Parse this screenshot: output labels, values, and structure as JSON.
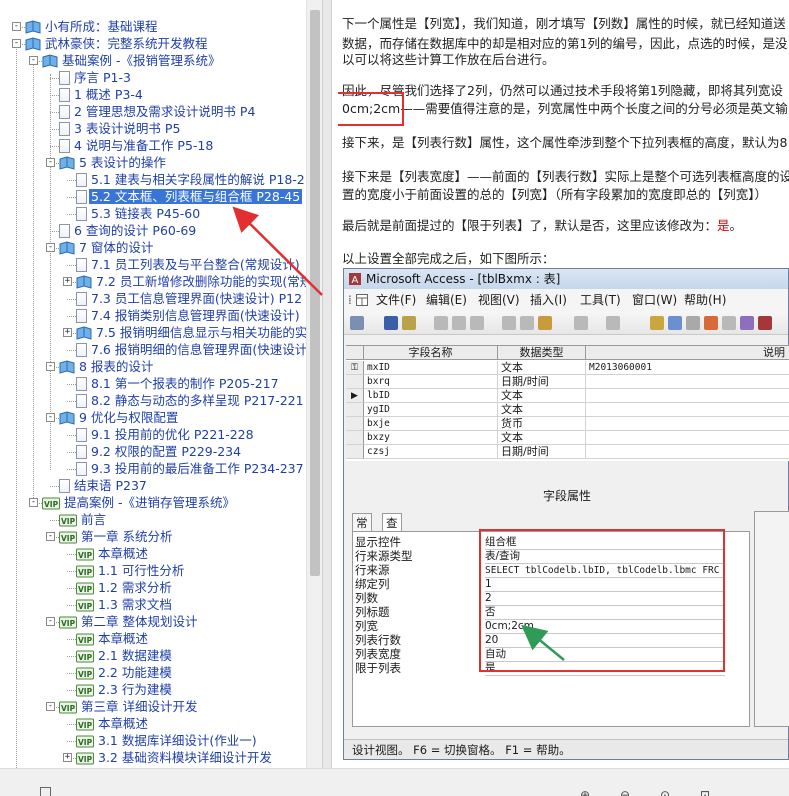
{
  "tree": {
    "rows": [
      {
        "label": "小有所成：基础课程",
        "icon": "book-icon",
        "depth": 0,
        "toggle": "-"
      },
      {
        "label": "武林豪侠：完整系统开发教程",
        "icon": "book-icon",
        "depth": 0,
        "toggle": "-"
      },
      {
        "label": "基础案例 -《报销管理系统》",
        "icon": "book-icon",
        "depth": 1,
        "toggle": "-"
      },
      {
        "label": "序言 P1-3",
        "icon": "page-icon",
        "depth": 2
      },
      {
        "label": "1 概述 P3-4",
        "icon": "page-icon",
        "depth": 2
      },
      {
        "label": "2 管理思想及需求设计说明书 P4",
        "icon": "page-icon",
        "depth": 2
      },
      {
        "label": "3 表设计说明书 P5",
        "icon": "page-icon",
        "depth": 2
      },
      {
        "label": "4 说明与准备工作 P5-18",
        "icon": "page-icon",
        "depth": 2
      },
      {
        "label": "5 表设计的操作",
        "icon": "book-icon",
        "depth": 2,
        "toggle": "-"
      },
      {
        "label": "5.1 建表与相关字段属性的解说 P18-2",
        "icon": "page-icon",
        "depth": 3
      },
      {
        "label": "5.2 文本框、列表框与组合框 P28-45",
        "icon": "page-icon",
        "depth": 3,
        "selected": true
      },
      {
        "label": "5.3 链接表 P45-60",
        "icon": "page-icon",
        "depth": 3
      },
      {
        "label": "6 查询的设计 P60-69",
        "icon": "page-icon",
        "depth": 2
      },
      {
        "label": "7 窗体的设计",
        "icon": "book-icon",
        "depth": 2,
        "toggle": "-"
      },
      {
        "label": "7.1 员工列表及与平台整合(常规设计)",
        "icon": "page-icon",
        "depth": 3
      },
      {
        "label": "7.2 员工新增修改删除功能的实现(常规",
        "icon": "book-icon",
        "depth": 3,
        "toggle": "+"
      },
      {
        "label": "7.3 员工信息管理界面(快速设计) P12",
        "icon": "page-icon",
        "depth": 3
      },
      {
        "label": "7.4 报销类别信息管理界面(快速设计)",
        "icon": "page-icon",
        "depth": 3
      },
      {
        "label": "7.5 报销明细信息显示与相关功能的实",
        "icon": "book-icon",
        "depth": 3,
        "toggle": "+"
      },
      {
        "label": "7.6 报销明细的信息管理界面(快速设计",
        "icon": "page-icon",
        "depth": 3
      },
      {
        "label": "8 报表的设计",
        "icon": "book-icon",
        "depth": 2,
        "toggle": "-"
      },
      {
        "label": "8.1 第一个报表的制作 P205-217",
        "icon": "page-icon",
        "depth": 3
      },
      {
        "label": "8.2 静态与动态的多样呈现 P217-221",
        "icon": "page-icon",
        "depth": 3
      },
      {
        "label": "9 优化与权限配置",
        "icon": "book-icon",
        "depth": 2,
        "toggle": "-"
      },
      {
        "label": "9.1 投用前的优化 P221-228",
        "icon": "page-icon",
        "depth": 3
      },
      {
        "label": "9.2 权限的配置 P229-234",
        "icon": "page-icon",
        "depth": 3
      },
      {
        "label": "9.3 投用前的最后准备工作 P234-237",
        "icon": "page-icon",
        "depth": 3
      },
      {
        "label": "结束语 P237",
        "icon": "page-icon",
        "depth": 2
      },
      {
        "label": "提高案例 -《进销存管理系统》",
        "icon": "vip-icon",
        "depth": 1,
        "toggle": "-"
      },
      {
        "label": "前言",
        "icon": "vip-icon",
        "depth": 2
      },
      {
        "label": "第一章 系统分析",
        "icon": "vip-icon",
        "depth": 2,
        "toggle": "-"
      },
      {
        "label": "本章概述",
        "icon": "vip-icon",
        "depth": 3
      },
      {
        "label": "1.1 可行性分析",
        "icon": "vip-icon",
        "depth": 3
      },
      {
        "label": "1.2 需求分析",
        "icon": "vip-icon",
        "depth": 3
      },
      {
        "label": "1.3 需求文档",
        "icon": "vip-icon",
        "depth": 3
      },
      {
        "label": "第二章 整体规划设计",
        "icon": "vip-icon",
        "depth": 2,
        "toggle": "-"
      },
      {
        "label": "本章概述",
        "icon": "vip-icon",
        "depth": 3
      },
      {
        "label": "2.1 数据建模",
        "icon": "vip-icon",
        "depth": 3
      },
      {
        "label": "2.2 功能建模",
        "icon": "vip-icon",
        "depth": 3
      },
      {
        "label": "2.3 行为建模",
        "icon": "vip-icon",
        "depth": 3
      },
      {
        "label": "第三章 详细设计开发",
        "icon": "vip-icon",
        "depth": 2,
        "toggle": "-"
      },
      {
        "label": "本章概述",
        "icon": "vip-icon",
        "depth": 3
      },
      {
        "label": "3.1 数据库详细设计(作业一)",
        "icon": "vip-icon",
        "depth": 3
      },
      {
        "label": "3.2 基础资料模块详细设计开发",
        "icon": "vip-icon",
        "depth": 3,
        "toggle": "+"
      }
    ]
  },
  "doc": {
    "paragraphs": [
      {
        "text": "下一个属性是【列宽】，我们知道，刚才填写【列数】属性的时候，就已经知道送"
      },
      {
        "text": "数据，而存储在数据库中的却是相对应的第1列的编号，因此，点选的时候，是没"
      },
      {
        "text": "以可以将这些计算工作放在后台进行。"
      },
      {
        "text": "因此，尽管我们选择了2列，仍然可以通过技术手段将第1列隐藏，即将其列宽设"
      },
      {
        "text": "0cm;2cm——需要值得注意的是，列宽属性中两个长度之间的分号必须是英文输"
      },
      {
        "text": "接下来，是【列表行数】属性，这个属性牵涉到整个下拉列表框的高度，默认为8"
      },
      {
        "text": "接下来是【列表宽度】——前面的【列表行数】实际上是整个可选列表框高度的设"
      },
      {
        "text": "置的宽度小于前面设置的总的【列宽】（所有字段累加的宽度即总的【列宽】）"
      },
      {
        "text_a": "最后就是前面提过的【限于列表】了，默认是否，这里应该修改为：",
        "text_b": "是",
        "text_c": "。"
      },
      {
        "text": "以上设置全部完成之后，如下图所示："
      }
    ]
  },
  "access": {
    "title": "Microsoft Access - [tblBxmx : 表]",
    "menu": [
      "文件(F)",
      "编辑(E)",
      "视图(V)",
      "插入(I)",
      "工具(T)",
      "窗口(W)",
      "帮助(H)"
    ],
    "columns": [
      "字段名称",
      "数据类型",
      "说明"
    ],
    "fields": [
      {
        "name": "mxID",
        "type": "文本",
        "desc": "M2013060001",
        "key": true
      },
      {
        "name": "bxrq",
        "type": "日期/时间",
        "desc": ""
      },
      {
        "name": "lbID",
        "type": "文本",
        "desc": "",
        "current": true
      },
      {
        "name": "ygID",
        "type": "文本",
        "desc": ""
      },
      {
        "name": "bxje",
        "type": "货币",
        "desc": ""
      },
      {
        "name": "bxzy",
        "type": "文本",
        "desc": ""
      },
      {
        "name": "czsj",
        "type": "日期/时间",
        "desc": ""
      }
    ],
    "props_title": "字段属性",
    "tabs": [
      "常规",
      "查阅"
    ],
    "props": [
      {
        "name": "显示控件",
        "value": "组合框"
      },
      {
        "name": "行来源类型",
        "value": "表/查询"
      },
      {
        "name": "行来源",
        "value": "SELECT tblCodelb.lbID, tblCodelb.lbmc FRC",
        "mono": true
      },
      {
        "name": "绑定列",
        "value": "1"
      },
      {
        "name": "列数",
        "value": "2"
      },
      {
        "name": "列标题",
        "value": "否"
      },
      {
        "name": "列宽",
        "value": "0cm;2cm"
      },
      {
        "name": "列表行数",
        "value": "20"
      },
      {
        "name": "列表宽度",
        "value": "自动"
      },
      {
        "name": "限于列表",
        "value": "是"
      }
    ],
    "status": "设计视图。    F6 = 切换窗格。   F1 = 帮助。"
  },
  "colors": {
    "selection": "#3875d7",
    "tree_text": "#1f3fa8",
    "annotation_red": "#e23030",
    "arrow_green": "#2e9b57"
  }
}
